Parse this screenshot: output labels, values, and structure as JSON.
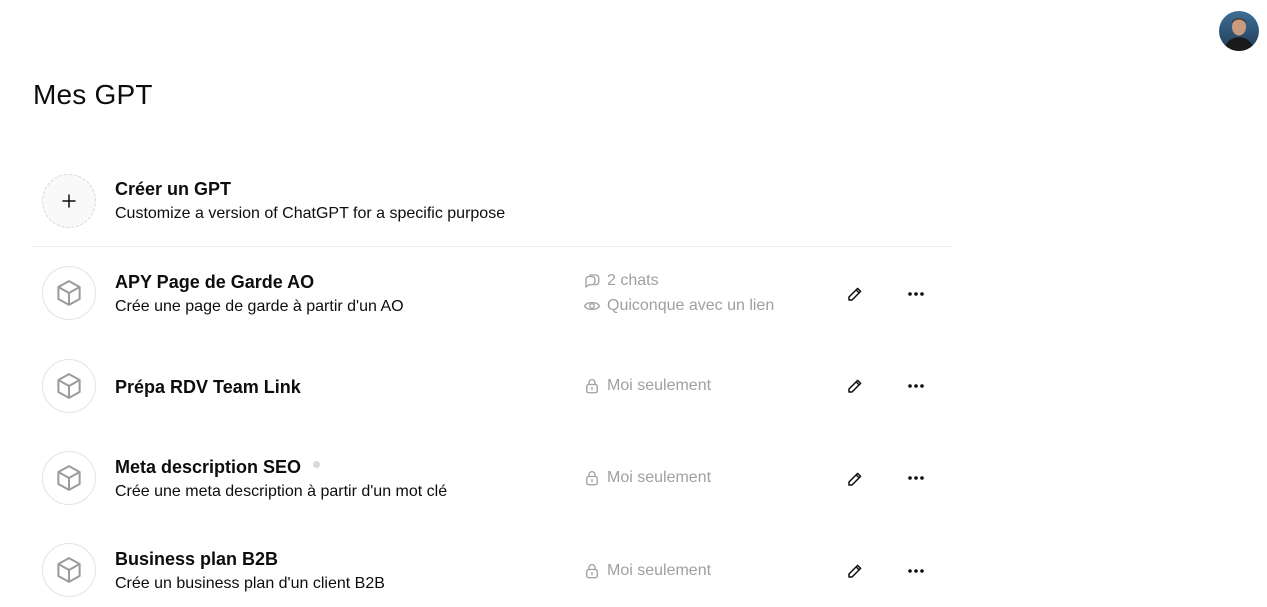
{
  "page": {
    "title": "Mes GPT"
  },
  "user": {
    "avatar": "user-avatar"
  },
  "create": {
    "title": "Créer un GPT",
    "subtitle": "Customize a version of ChatGPT for a specific purpose",
    "icon": "plus-icon"
  },
  "gpts": [
    {
      "name": "APY Page de Garde AO",
      "description": "Crée une page de garde à partir d'un AO",
      "chats": "2 chats",
      "visibility": "Quiconque avec un lien",
      "visibility_icon": "eye-icon"
    },
    {
      "name": "Prépa RDV Team Link",
      "description": "",
      "visibility": "Moi seulement",
      "visibility_icon": "lock-icon"
    },
    {
      "name": "Meta description SEO",
      "description": "Crée une meta description à partir d'un mot clé",
      "visibility": "Moi seulement",
      "visibility_icon": "lock-icon",
      "status_dot": true
    },
    {
      "name": "Business plan B2B",
      "description": "Crée un business plan d'un client B2B",
      "visibility": "Moi seulement",
      "visibility_icon": "lock-icon"
    }
  ],
  "colors": {
    "text": "#0d0d0d",
    "muted": "#a0a0a0",
    "divider": "#ececec",
    "icon_gray": "#9b9b9b"
  }
}
